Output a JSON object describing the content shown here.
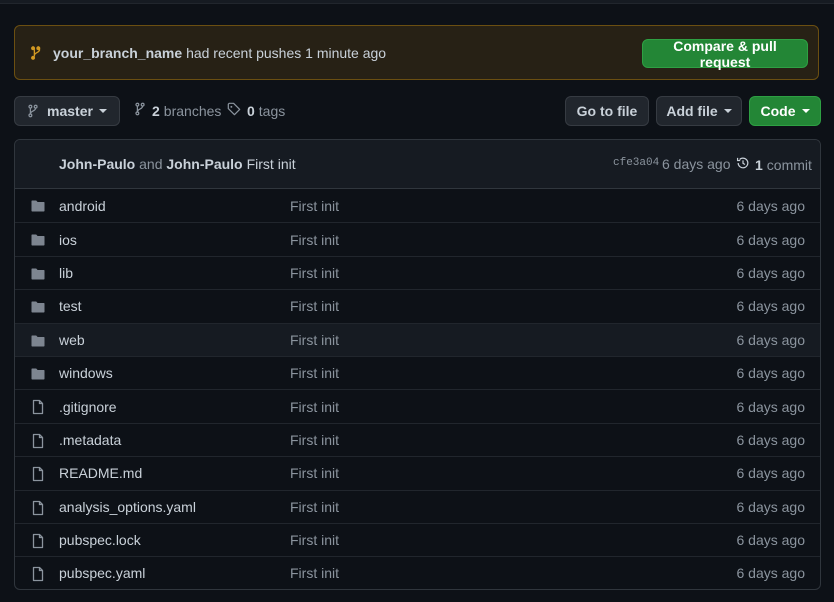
{
  "banner": {
    "branch_name": "your_branch_name",
    "message": "had recent pushes 1 minute ago",
    "compare_label": "Compare & pull request"
  },
  "toolbar": {
    "branch": "master",
    "branches_count": "2",
    "branches_label": "branches",
    "tags_count": "0",
    "tags_label": "tags",
    "go_to_file": "Go to file",
    "add_file": "Add file",
    "code": "Code"
  },
  "commit": {
    "author1": "John-Paulo",
    "and": "and",
    "author2": "John-Paulo",
    "message": "First init",
    "sha": "cfe3a04",
    "ago": "6 days ago",
    "count": "1",
    "count_label": "commit"
  },
  "files": [
    {
      "name": "android",
      "type": "folder",
      "message": "First init",
      "age": "6 days ago"
    },
    {
      "name": "ios",
      "type": "folder",
      "message": "First init",
      "age": "6 days ago"
    },
    {
      "name": "lib",
      "type": "folder",
      "message": "First init",
      "age": "6 days ago"
    },
    {
      "name": "test",
      "type": "folder",
      "message": "First init",
      "age": "6 days ago"
    },
    {
      "name": "web",
      "type": "folder",
      "message": "First init",
      "age": "6 days ago"
    },
    {
      "name": "windows",
      "type": "folder",
      "message": "First init",
      "age": "6 days ago"
    },
    {
      "name": ".gitignore",
      "type": "file",
      "message": "First init",
      "age": "6 days ago"
    },
    {
      "name": ".metadata",
      "type": "file",
      "message": "First init",
      "age": "6 days ago"
    },
    {
      "name": "README.md",
      "type": "file",
      "message": "First init",
      "age": "6 days ago"
    },
    {
      "name": "analysis_options.yaml",
      "type": "file",
      "message": "First init",
      "age": "6 days ago"
    },
    {
      "name": "pubspec.lock",
      "type": "file",
      "message": "First init",
      "age": "6 days ago"
    },
    {
      "name": "pubspec.yaml",
      "type": "file",
      "message": "First init",
      "age": "6 days ago"
    }
  ],
  "colors": {
    "background": "#0d1117",
    "banner_bg": "#272115",
    "banner_border": "#6b4f11",
    "accent_green": "#238636",
    "folder_icon": "#7d8590"
  }
}
